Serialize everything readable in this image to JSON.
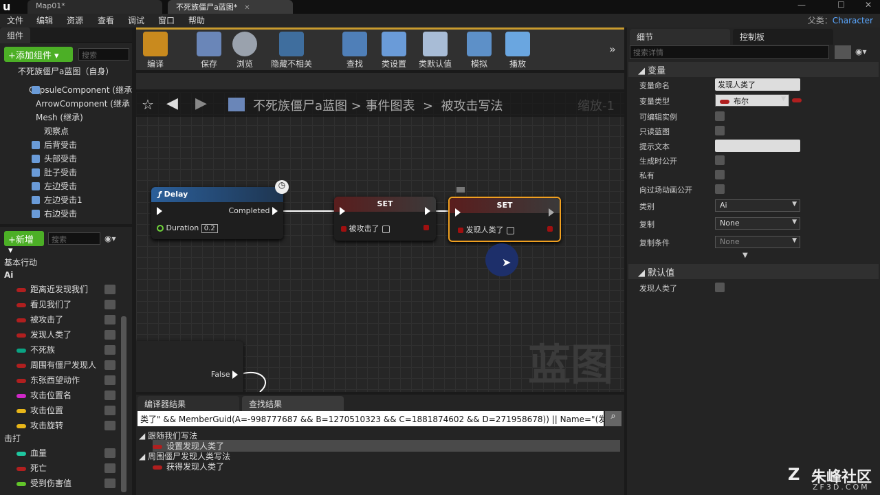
{
  "titlebar": {
    "logo": "u",
    "tabs": [
      {
        "label": "Map01*"
      },
      {
        "label": "不死族僵尸a蓝图*"
      }
    ]
  },
  "menubar": {
    "items": [
      "文件",
      "编辑",
      "资源",
      "查看",
      "调试",
      "窗口",
      "帮助"
    ],
    "parent_label": "父类：",
    "parent_value": "Character"
  },
  "components": {
    "tab": "组件",
    "add_button": "添加组件",
    "search_placeholder": "搜索",
    "root": "不死族僵尸a蓝图（自身）",
    "items": [
      "CapsuleComponent (继承",
      "ArrowComponent (继承",
      "Mesh (继承)",
      "观察点",
      "后背受击",
      "头部受击",
      "肚子受击",
      "左边受击",
      "左边受击1",
      "右边受击"
    ]
  },
  "mybp": {
    "new_button": "新增",
    "search_placeholder": "搜索",
    "cat_basic": "基本行动",
    "cat_ai": "Ai",
    "cat_hit": "击打",
    "ai_vars": [
      {
        "name": "距离近发现我们",
        "color": "#b01f1f"
      },
      {
        "name": "看见我们了",
        "color": "#b01f1f"
      },
      {
        "name": "被攻击了",
        "color": "#b01f1f"
      },
      {
        "name": "发现人类了",
        "color": "#b01f1f"
      },
      {
        "name": "不死族",
        "color": "#0aa383"
      },
      {
        "name": "周围有僵尸发现人",
        "color": "#b01f1f"
      },
      {
        "name": "东张西望动作",
        "color": "#b01f1f"
      },
      {
        "name": "攻击位置名",
        "color": "#d028c8"
      },
      {
        "name": "攻击位置",
        "color": "#e8b619"
      },
      {
        "name": "攻击旋转",
        "color": "#e8b619"
      }
    ],
    "hit_vars": [
      {
        "name": "血量",
        "color": "#1fc7a0"
      },
      {
        "name": "死亡",
        "color": "#b01f1f"
      },
      {
        "name": "受到伤害值",
        "color": "#62c52a"
      }
    ]
  },
  "toolbar": {
    "items": [
      "编译",
      "保存",
      "浏览",
      "隐藏不相关",
      "查找",
      "类设置",
      "类默认值",
      "模拟",
      "播放"
    ]
  },
  "graph": {
    "breadcrumb": [
      "不死族僵尸a蓝图",
      "事件图表",
      "被攻击写法"
    ],
    "zoom": "缩放-1",
    "watermark": "蓝图",
    "delay": {
      "title": "Delay",
      "completed": "Completed",
      "duration_label": "Duration",
      "duration_value": "0.2"
    },
    "set1": {
      "title": "SET",
      "var": "被攻击了"
    },
    "set2": {
      "title": "SET",
      "var": "发现人类了"
    },
    "false_label": "False"
  },
  "results": {
    "tab1": "编译器结果",
    "tab2": "查找结果",
    "query": "类了\" && MemberGuid(A=-998777687 && B=1270510323 && C=1881874602 && D=271958678)) || Name=\"(发现人类了)\")",
    "rows": [
      {
        "label": "跟随我们写法",
        "indent": 0
      },
      {
        "label": "设置发现人类了",
        "indent": 1
      },
      {
        "label": "周围僵尸发现人类写法",
        "indent": 0
      },
      {
        "label": "获得发现人类了",
        "indent": 1
      }
    ]
  },
  "details": {
    "tab1": "细节",
    "tab2": "控制板",
    "search_placeholder": "搜索详情",
    "section_var": "变量",
    "section_default": "默认值",
    "var_name_label": "变量命名",
    "var_name_value": "发现人类了",
    "var_type_label": "变量类型",
    "var_type_value": "布尔",
    "editable_label": "可编辑实例",
    "readonly_label": "只读蓝图",
    "tooltip_label": "提示文本",
    "expose_spawn_label": "生成时公开",
    "private_label": "私有",
    "expose_cine_label": "向过场动画公开",
    "category_label": "类别",
    "category_value": "Ai",
    "replication_label": "复制",
    "replication_value": "None",
    "repcond_label": "复制条件",
    "repcond_value": "None",
    "default_var_label": "发现人类了"
  },
  "brand": {
    "name": "朱峰社区",
    "url": "ZF3D.COM"
  }
}
